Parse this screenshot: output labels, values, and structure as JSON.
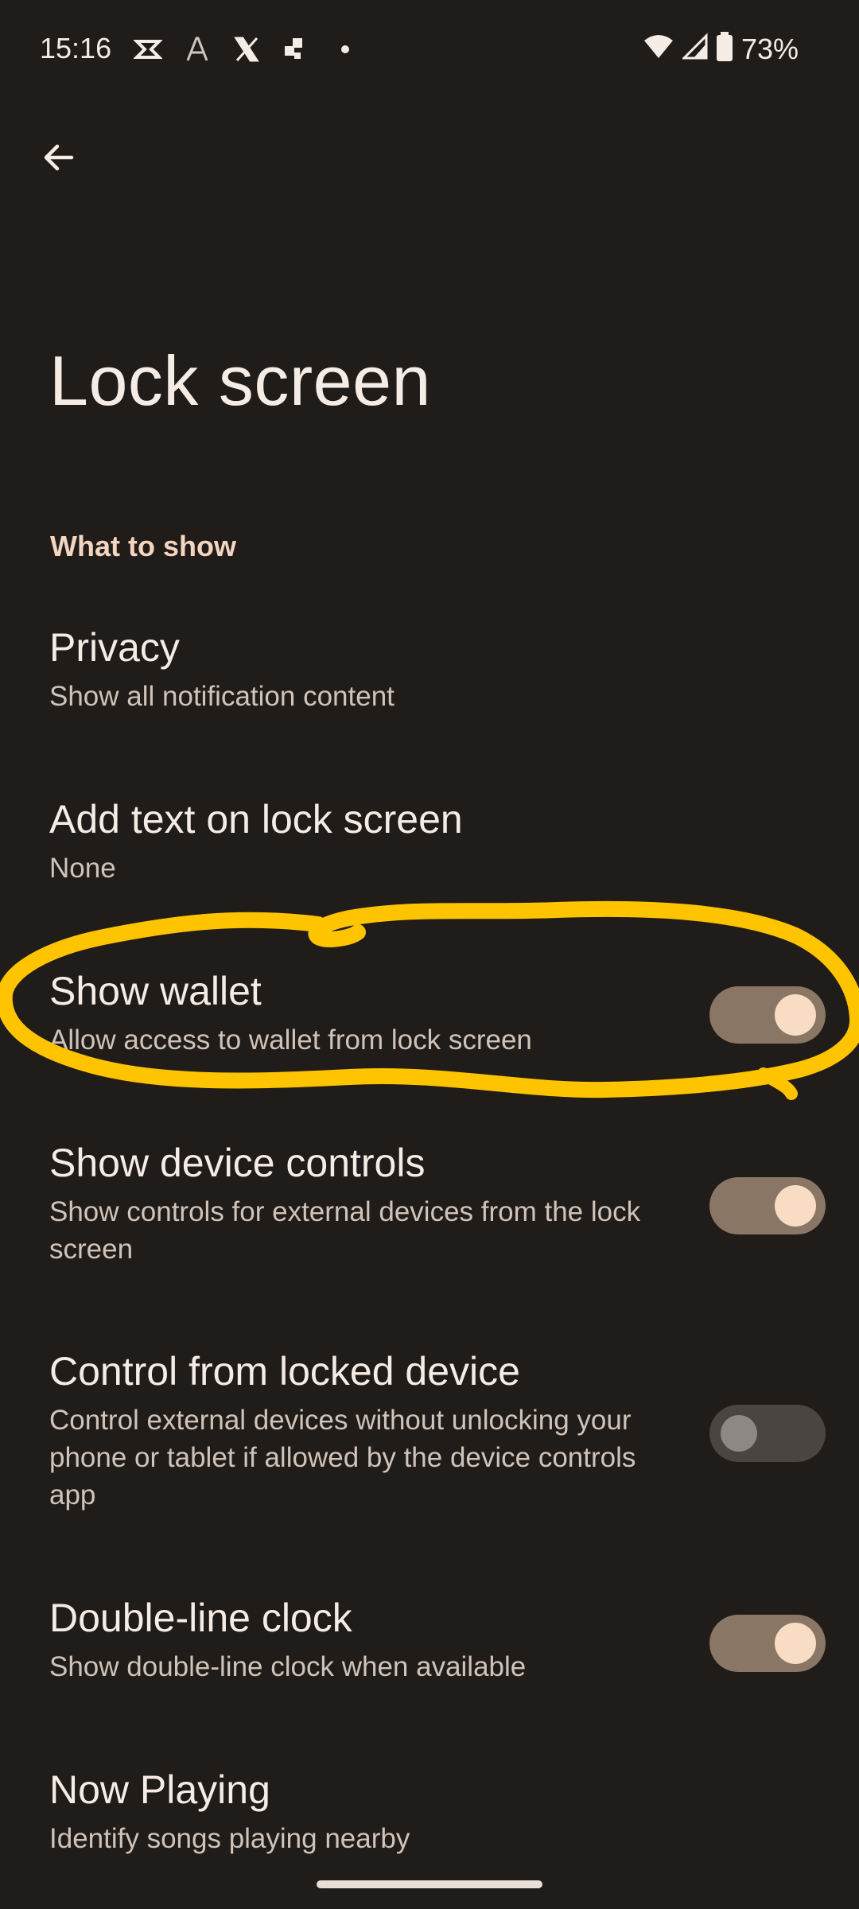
{
  "status_bar": {
    "time": "15:16",
    "battery": "73%",
    "icons_left": [
      "capcut-icon",
      "font-icon",
      "x-icon",
      "app-icon",
      "dot-icon"
    ],
    "icons_right": [
      "wifi-icon",
      "signal-icon",
      "battery-icon"
    ]
  },
  "header": {
    "back_icon": "arrow-back-icon",
    "title": "Lock screen"
  },
  "section": {
    "label": "What to show"
  },
  "items": [
    {
      "title": "Privacy",
      "summary": "Show all notification content"
    },
    {
      "title": "Add text on lock screen",
      "summary": "None"
    },
    {
      "title": "Show wallet",
      "summary": "Allow access to wallet from lock screen",
      "toggle": true
    },
    {
      "title": "Show device controls",
      "summary": "Show controls for external devices from the lock screen",
      "toggle": true
    },
    {
      "title": "Control from locked device",
      "summary": "Control external devices without unlocking your phone or tablet if allowed by the device controls app",
      "toggle": false
    },
    {
      "title": "Double-line clock",
      "summary": "Show double-line clock when available",
      "toggle": true
    },
    {
      "title": "Now Playing",
      "summary": "Identify songs playing nearby"
    }
  ],
  "colors": {
    "background": "#201c19",
    "accent": "#f3d5c0",
    "switch_on_track": "#8a7665",
    "switch_on_thumb": "#f9dcc4",
    "switch_off_track": "#4a4541",
    "annotation": "#ffc400"
  }
}
